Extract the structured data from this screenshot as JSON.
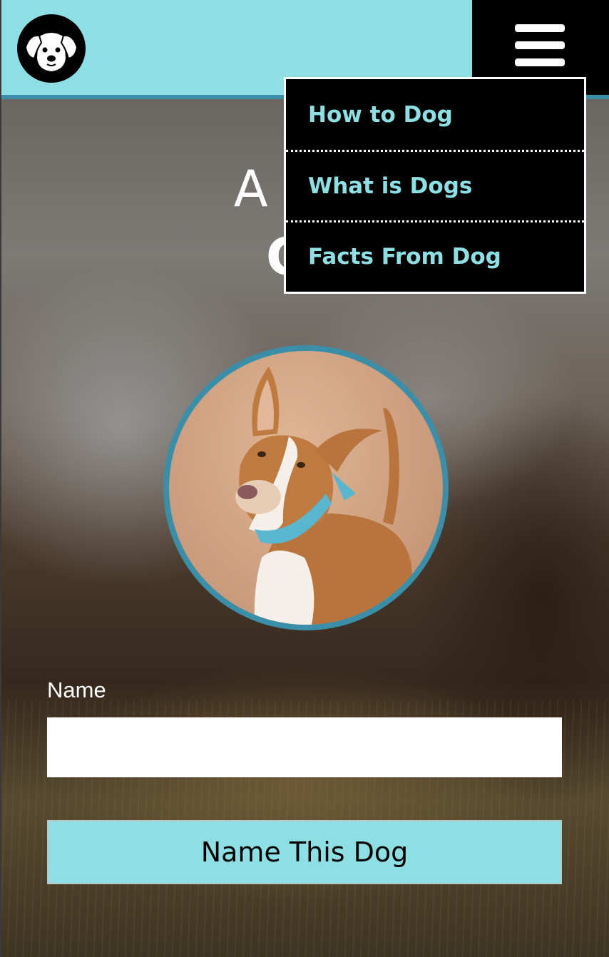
{
  "header": {
    "logo_icon": "dog-face-icon",
    "menu_icon": "hamburger-menu-icon",
    "background_color": "#8ddfe3",
    "stripe_color": "#3b8ea8"
  },
  "nav_menu": {
    "items": [
      {
        "label": "How to Dog"
      },
      {
        "label": "What is Dogs"
      },
      {
        "label": "Facts From Dog"
      }
    ],
    "link_color": "#8ddfe3"
  },
  "hero": {
    "title_line1": "A Site",
    "title_line2": "Ge"
  },
  "dog_photo": {
    "icon": "dog-portrait",
    "border_color": "#3b8ea8"
  },
  "form": {
    "name_label": "Name",
    "name_value": "",
    "name_placeholder": "",
    "submit_label": "Name This Dog",
    "button_color": "#8ddfe3"
  }
}
